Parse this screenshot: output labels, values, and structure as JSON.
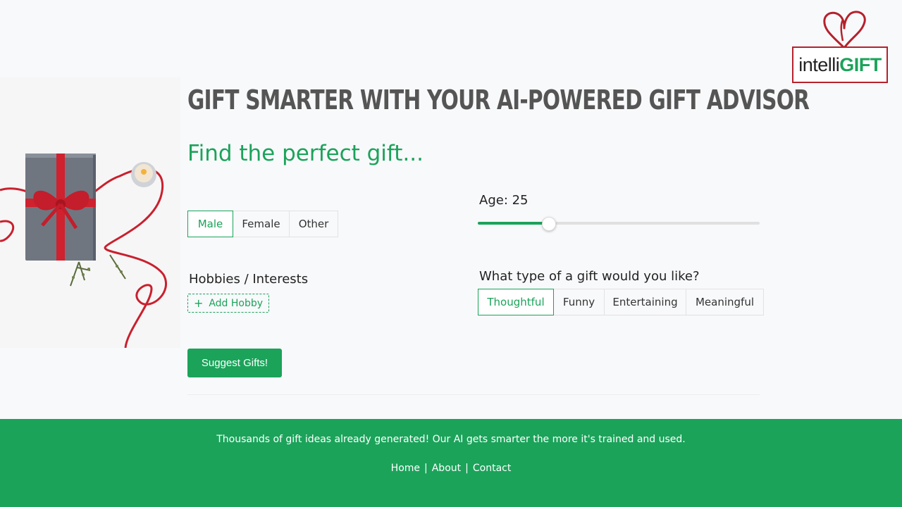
{
  "brand": {
    "logo_light": "intelli",
    "logo_bold": "GIFT",
    "accent_color": "#1ba35a",
    "logo_color": "#b5212c"
  },
  "hero": {
    "headline": "GIFT SMARTER WITH YOUR AI-POWERED GIFT ADVISOR",
    "subhead": "Find the perfect gift..."
  },
  "gender": {
    "options": [
      "Male",
      "Female",
      "Other"
    ],
    "selected": "Male"
  },
  "age": {
    "label": "Age: 25",
    "value": 25,
    "fill_fraction": 0.25
  },
  "hobbies": {
    "label": "Hobbies / Interests",
    "add_button": "Add Hobby"
  },
  "gift_type": {
    "question": "What type of a gift would you like?",
    "options": [
      "Thoughtful",
      "Funny",
      "Entertaining",
      "Meaningful"
    ],
    "selected": "Thoughtful"
  },
  "actions": {
    "suggest": "Suggest Gifts!"
  },
  "footer": {
    "tagline": "Thousands of gift ideas already generated! Our AI gets smarter the more it's trained and used.",
    "links": [
      "Home",
      "About",
      "Contact"
    ],
    "separator": "|"
  }
}
